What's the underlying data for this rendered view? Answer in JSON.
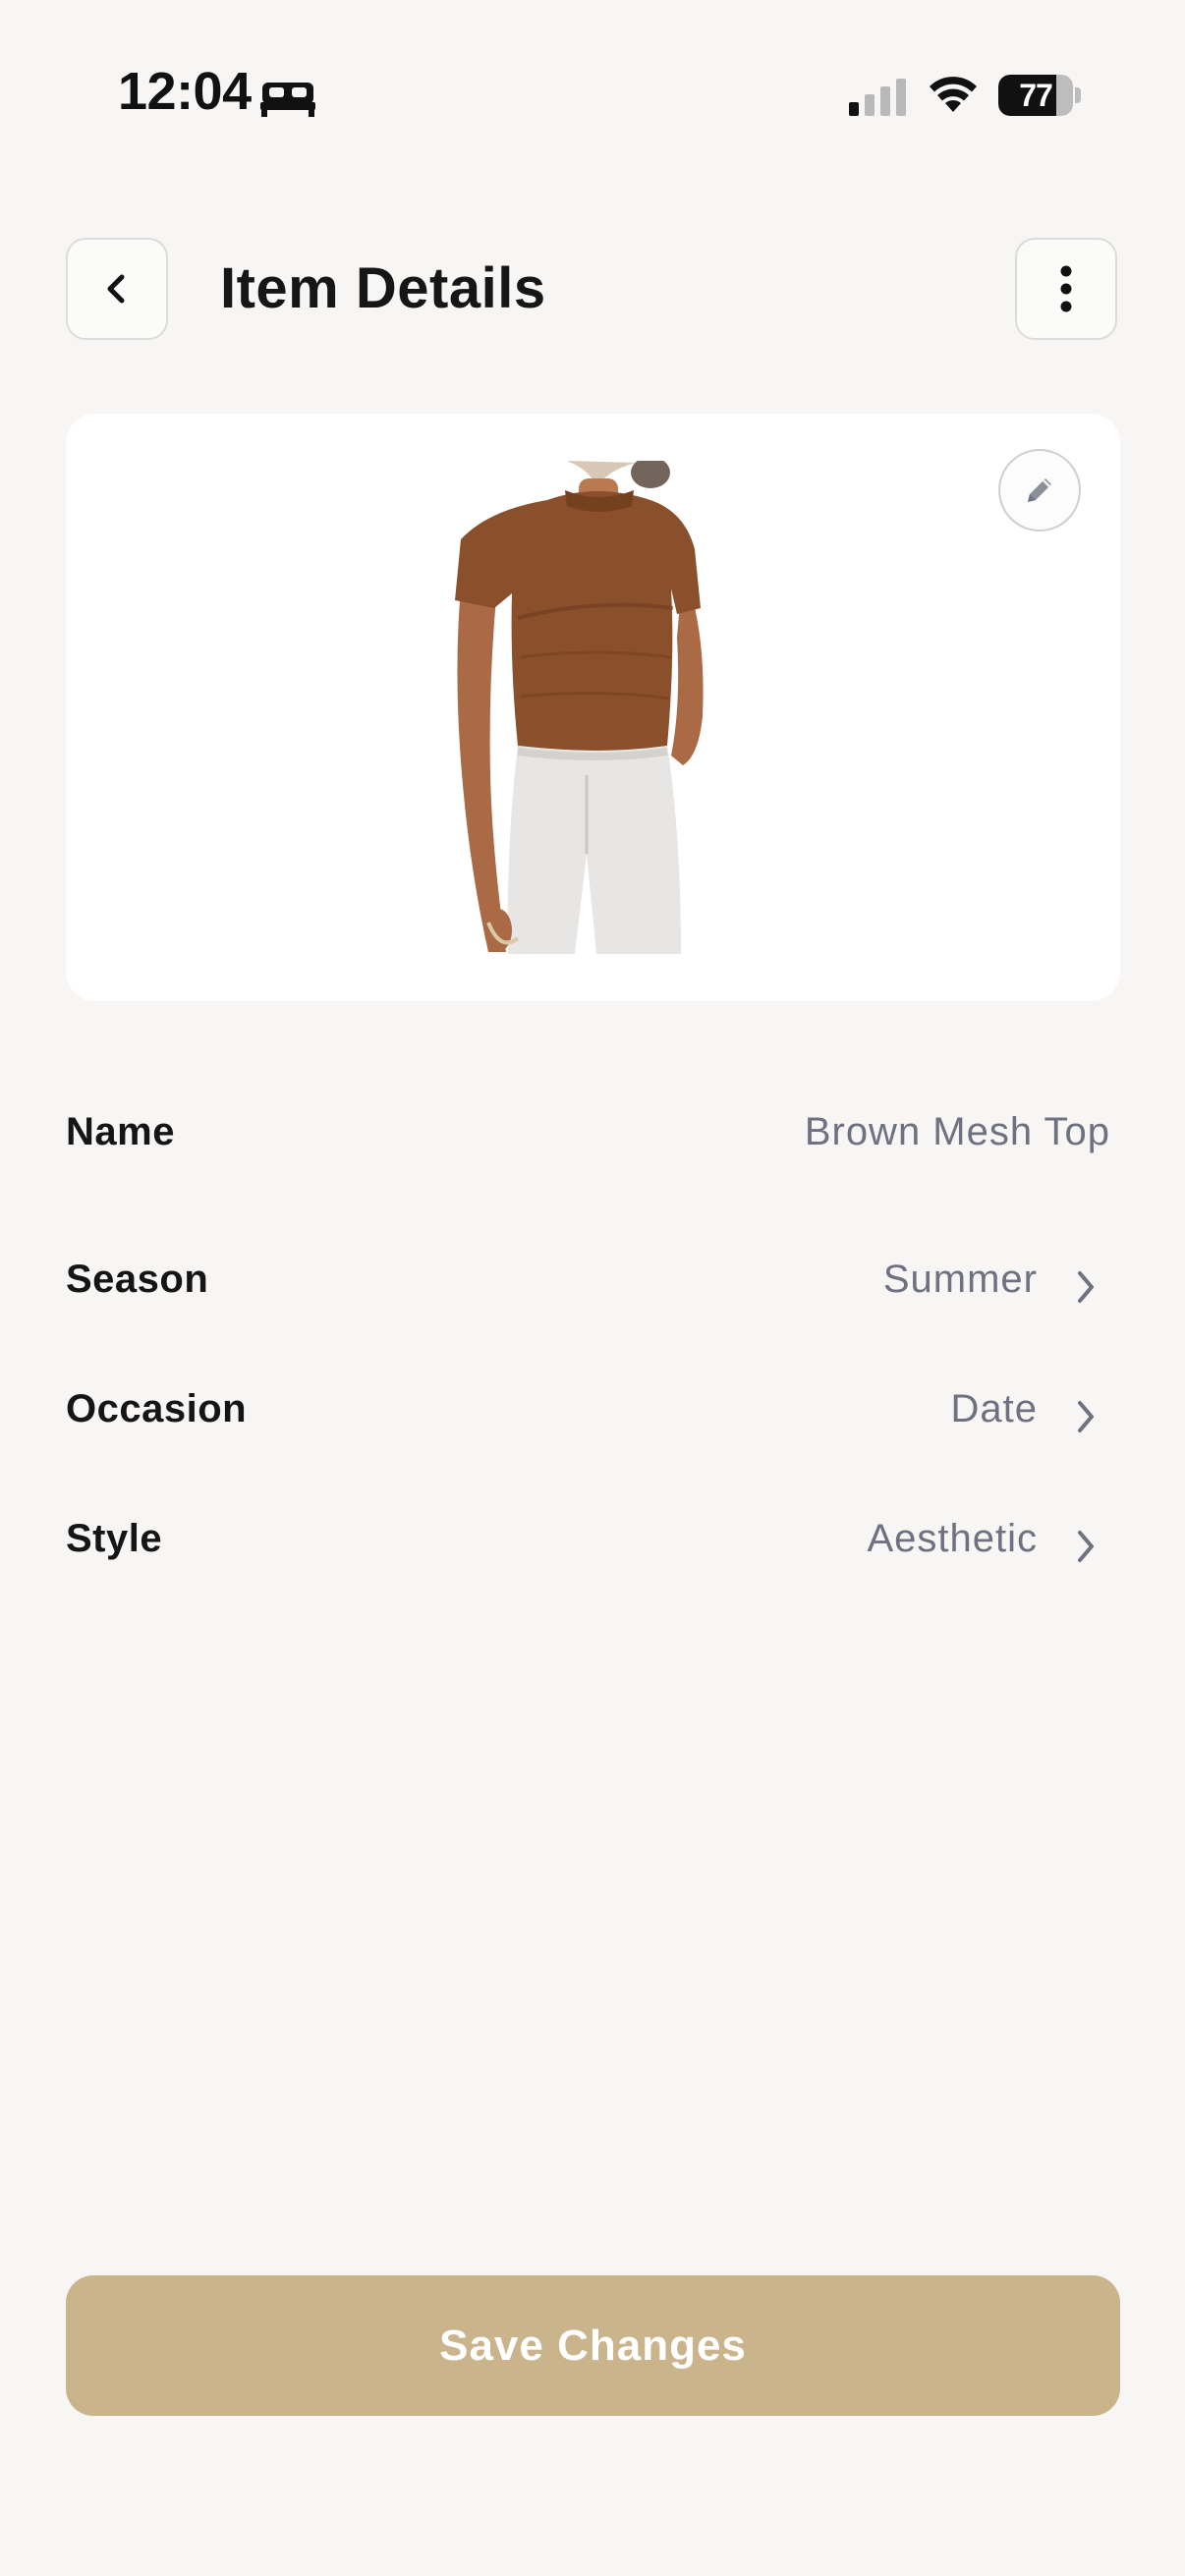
{
  "status_bar": {
    "time": "12:04",
    "battery_level": "77",
    "battery_fraction": 0.77,
    "focus_icon": "bed-icon",
    "signal_icon": "cellular-signal-icon",
    "wifi_icon": "wifi-icon"
  },
  "header": {
    "title": "Item Details",
    "back_icon": "chevron-left-icon",
    "more_icon": "more-vertical-icon"
  },
  "item_image": {
    "edit_icon": "pencil-icon"
  },
  "details": {
    "name": {
      "label": "Name",
      "value": "Brown Mesh Top"
    },
    "season": {
      "label": "Season",
      "value": "Summer"
    },
    "occasion": {
      "label": "Occasion",
      "value": "Date"
    },
    "style": {
      "label": "Style",
      "value": "Aesthetic"
    }
  },
  "actions": {
    "save_label": "Save Changes"
  },
  "colors": {
    "background": "#f7f6f4",
    "accent": "#c9b48b",
    "value_text": "#6d7180",
    "garment": "#8a4f2b"
  }
}
